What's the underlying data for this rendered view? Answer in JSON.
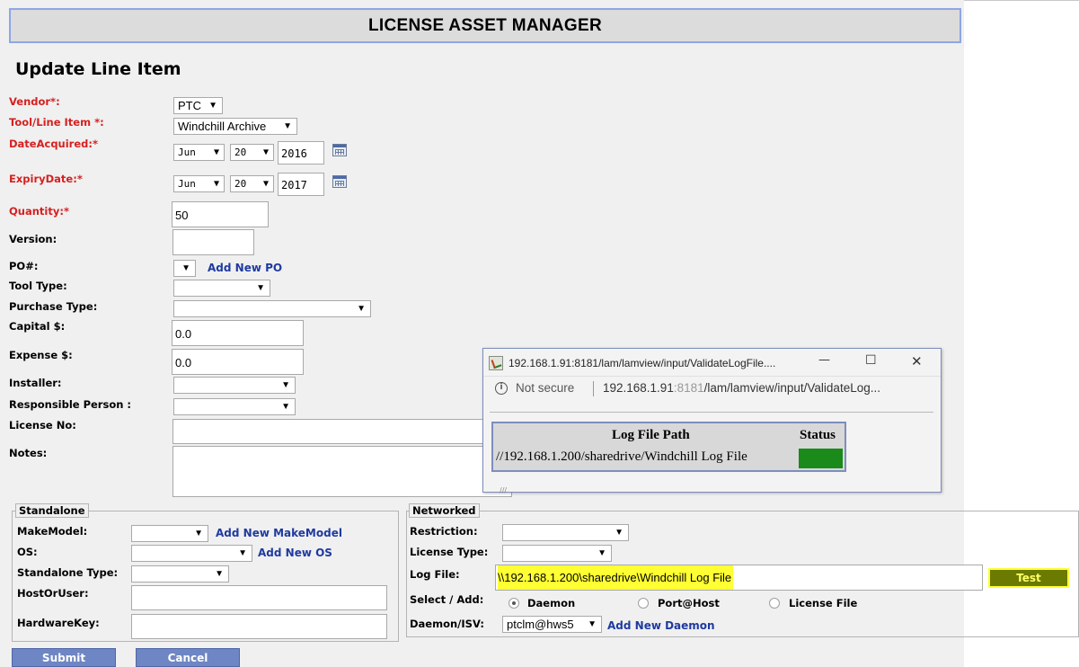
{
  "banner": "LICENSE ASSET MANAGER",
  "heading": "Update Line Item",
  "form": {
    "vendor_label": "Vendor*:",
    "vendor_value": "PTC",
    "tool_label": "Tool/Line Item *:",
    "tool_value": "Windchill Archive",
    "date_acquired_label": "DateAcquired:*",
    "date_acquired": {
      "month": "Jun",
      "day": "20",
      "year": "2016"
    },
    "expiry_label": "ExpiryDate:*",
    "expiry": {
      "month": "Jun",
      "day": "20",
      "year": "2017"
    },
    "quantity_label": "Quantity:*",
    "quantity_value": "50",
    "version_label": "Version:",
    "version_value": "",
    "po_label": "PO#:",
    "po_value": "",
    "add_po": "Add New PO",
    "tool_type_label": "Tool Type:",
    "tool_type_value": "",
    "purchase_type_label": "Purchase Type:",
    "purchase_type_value": "",
    "capital_label": "Capital $:",
    "capital_value": "0.0",
    "expense_label": "Expense $:",
    "expense_value": "0.0",
    "installer_label": "Installer:",
    "installer_value": "",
    "responsible_label": "Responsible Person :",
    "responsible_value": "",
    "license_no_label": "License No:",
    "license_no_value": "",
    "notes_label": "Notes:",
    "notes_value": ""
  },
  "standalone": {
    "legend": "Standalone",
    "makemodel_label": "MakeModel:",
    "makemodel_value": "",
    "add_makemodel": "Add New MakeModel",
    "os_label": "OS:",
    "os_value": "",
    "add_os": "Add New OS",
    "type_label": "Standalone Type:",
    "type_value": "",
    "host_label": "HostOrUser:",
    "host_value": "",
    "hwkey_label": "HardwareKey:",
    "hwkey_value": ""
  },
  "networked": {
    "legend": "Networked",
    "restriction_label": "Restriction:",
    "restriction_value": "",
    "license_type_label": "License Type:",
    "license_type_value": "",
    "log_file_label": "Log File:",
    "log_file_value": "\\\\192.168.1.200\\sharedrive\\Windchill Log File",
    "test_button": "Test",
    "select_add_label": "Select / Add:",
    "radio_options": [
      "Daemon",
      "Port@Host",
      "License File"
    ],
    "selected_option": "Daemon",
    "daemon_label": "Daemon/ISV:",
    "daemon_value": "ptclm@hws5",
    "add_daemon": "Add New Daemon"
  },
  "buttons": {
    "submit": "Submit",
    "cancel": "Cancel"
  },
  "popup": {
    "title": "192.168.1.91:8181/lam/lamview/input/ValidateLogFile....",
    "minimize": "—",
    "maximize": "☐",
    "close": "✕",
    "security": "Not secure",
    "url_host": "192.168.1.91",
    "url_port": ":8181",
    "url_path": "/lam/lamview/input/ValidateLog...",
    "col_path": "Log File Path",
    "col_status": "Status",
    "row_path": "//192.168.1.200/sharedrive/Windchill Log File",
    "status_color": "#1a8a1a"
  },
  "colors": {
    "required": "#d62020",
    "link": "#1f3aa0",
    "button": "#6e86c4",
    "highlight": "#ffff33",
    "test_button": "#6b7a00"
  }
}
